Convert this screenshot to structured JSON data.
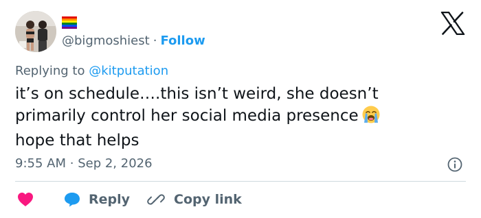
{
  "user": {
    "handle": "@bigmoshiest",
    "follow_label": "Follow",
    "separator": "·"
  },
  "reply_context": {
    "prefix": "Replying to",
    "mention": "@kitputation"
  },
  "tweet": {
    "lines": [
      "it’s on schedule….this isn’t weird, she doesn’t",
      "primarily control her social media presence",
      "hope that helps"
    ]
  },
  "meta": {
    "time": "9:55 AM",
    "separator": "·",
    "date": "Sep 2, 2026"
  },
  "actions": {
    "reply_label": "Reply",
    "copy_link_label": "Copy link"
  },
  "colors": {
    "accent": "#1d9bf0",
    "like": "#f91880",
    "text": "#0f1419",
    "muted": "#536471",
    "divider": "#cfd9de"
  },
  "icons": [
    "pride-flag-icon",
    "x-logo-icon",
    "crying-face-emoji-icon",
    "info-icon",
    "heart-icon",
    "reply-bubble-icon",
    "link-icon"
  ]
}
